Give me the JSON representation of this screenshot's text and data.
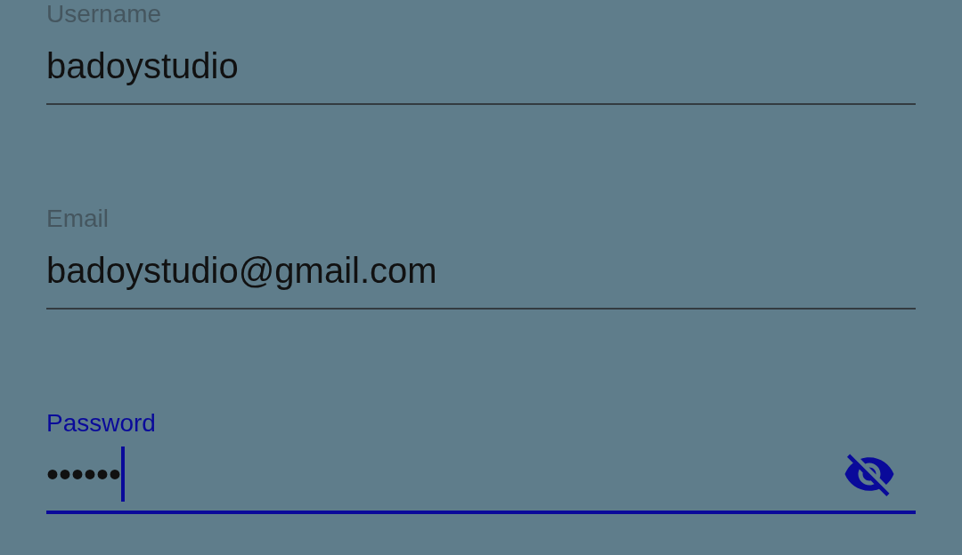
{
  "fields": [
    {
      "kind": "text",
      "label": "Username",
      "value": "badoystudio",
      "focused": false
    },
    {
      "kind": "text",
      "label": "Email",
      "value": "badoystudio@gmail.com",
      "focused": false
    },
    {
      "kind": "password",
      "label": "Password",
      "value": "••••••",
      "focused": true
    }
  ]
}
